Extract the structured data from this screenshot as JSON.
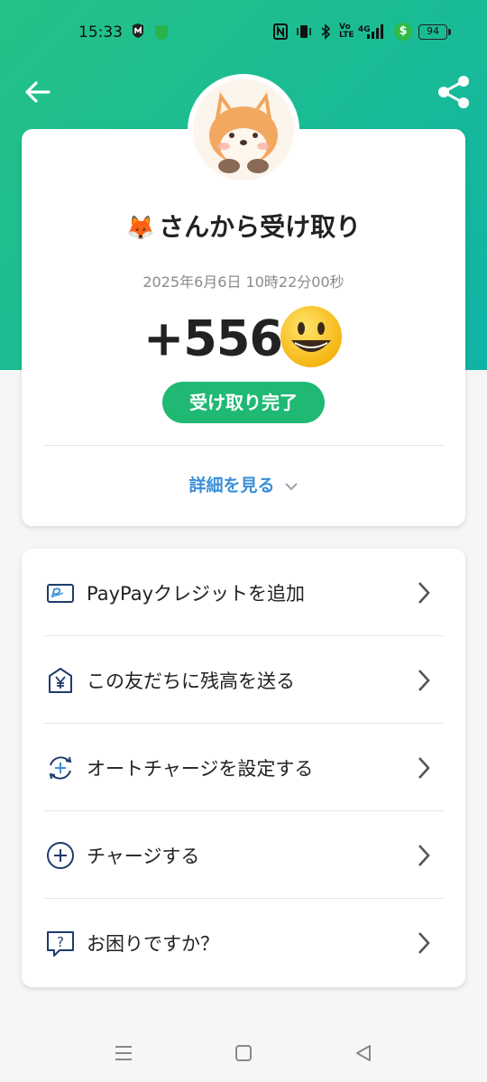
{
  "status_bar": {
    "time": "15:33",
    "battery": "94",
    "charge_symbol": "$",
    "network": "4G"
  },
  "header": {
    "back_icon": "arrow-left-icon",
    "share_icon": "share-icon"
  },
  "receipt": {
    "sender_emoji": "🦊",
    "title": "さんから受け取り",
    "timestamp": "2025年6月6日 10時22分00秒",
    "amount": "+556",
    "status": "受け取り完了",
    "details_link": "詳細を見る"
  },
  "menu": {
    "items": [
      {
        "label": "PayPayクレジットを追加",
        "icon": "credit-card-icon"
      },
      {
        "label": "この友だちに残高を送る",
        "icon": "yen-send-icon"
      },
      {
        "label": "オートチャージを設定する",
        "icon": "auto-charge-icon"
      },
      {
        "label": "チャージする",
        "icon": "plus-circle-icon"
      },
      {
        "label": "お困りですか？",
        "icon": "help-bubble-icon"
      }
    ]
  },
  "colors": {
    "brand_green": "#20b974",
    "link_blue": "#3a8fd9",
    "icon_navy": "#1f3b6e"
  }
}
